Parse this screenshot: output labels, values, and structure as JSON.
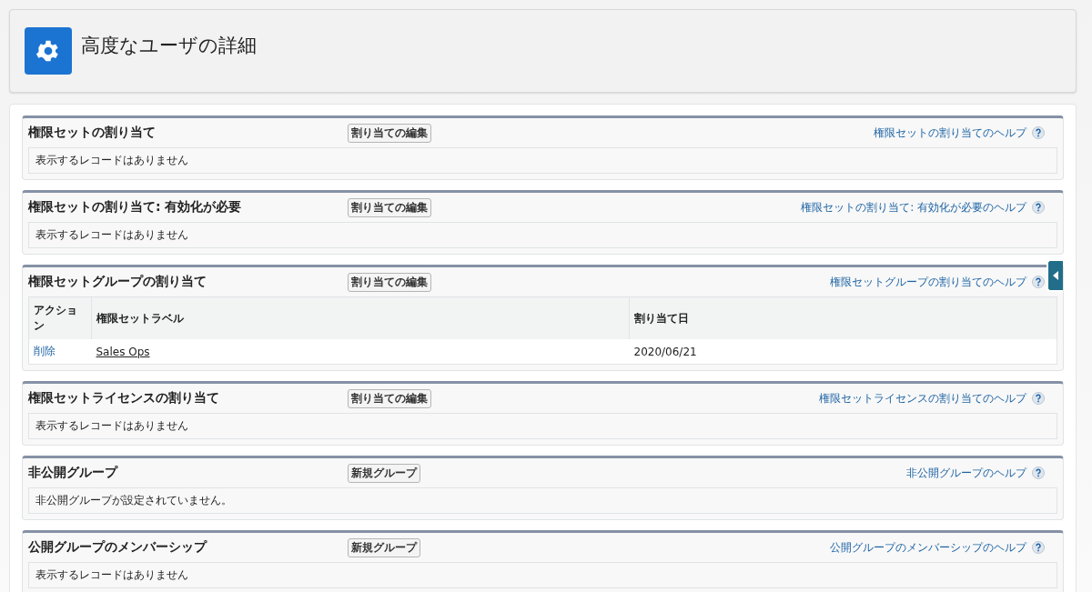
{
  "header": {
    "title": "高度なユーザの詳細"
  },
  "sections": [
    {
      "kind": "empty",
      "title": "権限セットの割り当て",
      "button": "割り当ての編集",
      "help": "権限セットの割り当てのヘルプ",
      "message": "表示するレコードはありません"
    },
    {
      "kind": "empty",
      "title": "権限セットの割り当て: 有効化が必要",
      "button": "割り当ての編集",
      "help": "権限セットの割り当て: 有効化が必要のヘルプ",
      "message": "表示するレコードはありません"
    },
    {
      "kind": "table",
      "title": "権限セットグループの割り当て",
      "button": "割り当ての編集",
      "help": "権限セットグループの割り当てのヘルプ",
      "columns": [
        "アクション",
        "権限セットラベル",
        "割り当て日"
      ],
      "rows": [
        {
          "action": "削除",
          "label": "Sales Ops",
          "date": "2020/06/21"
        }
      ]
    },
    {
      "kind": "empty",
      "title": "権限セットライセンスの割り当て",
      "button": "割り当ての編集",
      "help": "権限セットライセンスの割り当てのヘルプ",
      "message": "表示するレコードはありません"
    },
    {
      "kind": "empty",
      "title": "非公開グループ",
      "button": "新規グループ",
      "help": "非公開グループのヘルプ",
      "message": "非公開グループが設定されていません。"
    },
    {
      "kind": "empty",
      "title": "公開グループのメンバーシップ",
      "button": "新規グループ",
      "help": "公開グループのメンバーシップのヘルプ",
      "message": "表示するレコードはありません"
    }
  ]
}
